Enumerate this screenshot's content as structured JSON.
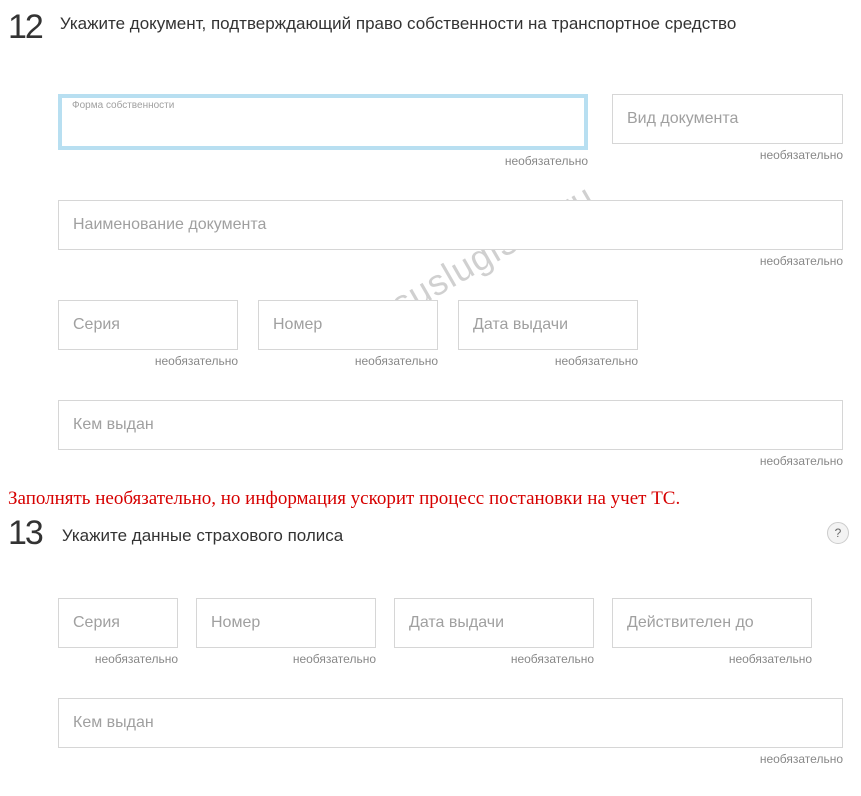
{
  "section12": {
    "number": "12",
    "title": "Укажите документ, подтверждающий право собственности на транспортное средство",
    "ownership_form": {
      "label": "Форма собственности",
      "optional": "необязательно"
    },
    "doc_type": {
      "placeholder": "Вид документа",
      "optional": "необязательно"
    },
    "doc_name": {
      "placeholder": "Наименование документа",
      "optional": "необязательно"
    },
    "series": {
      "placeholder": "Серия",
      "optional": "необязательно"
    },
    "number_field": {
      "placeholder": "Номер",
      "optional": "необязательно"
    },
    "issue_date": {
      "placeholder": "Дата выдачи",
      "optional": "необязательно"
    },
    "issued_by": {
      "placeholder": "Кем выдан",
      "optional": "необязательно"
    }
  },
  "note_text": "Заполнять необязательно, но информация ускорит процесс постановки на учет ТС.",
  "section13": {
    "number": "13",
    "title": "Укажите данные страхового полиса",
    "help": "?",
    "series": {
      "placeholder": "Серия",
      "optional": "необязательно"
    },
    "number_field": {
      "placeholder": "Номер",
      "optional": "необязательно"
    },
    "issue_date": {
      "placeholder": "Дата выдачи",
      "optional": "необязательно"
    },
    "valid_until": {
      "placeholder": "Действителен до",
      "optional": "необязательно"
    },
    "issued_by": {
      "placeholder": "Кем выдан",
      "optional": "необязательно"
    }
  },
  "watermark": "gosuslugi365.ru"
}
